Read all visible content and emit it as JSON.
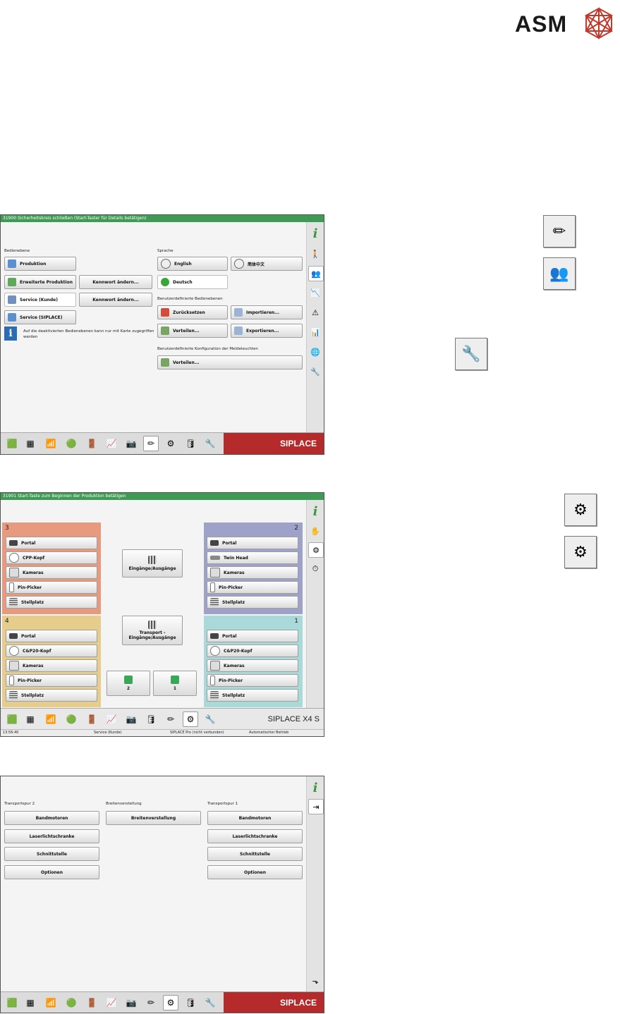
{
  "brand": {
    "logo_text": "ASM"
  },
  "screen1": {
    "status": "31900 Sicherheitskreis schließen (Start-Taster für Details betätigen)",
    "left_label": "Bedienebene",
    "levels": [
      {
        "label": "Produktion"
      },
      {
        "label": "Erweiterte Produktion"
      },
      {
        "label": "Service (Kunde)"
      },
      {
        "label": "Service (SIPLACE)"
      }
    ],
    "pw_buttons": [
      "Kennwort ändern...",
      "Kennwort ändern..."
    ],
    "info_text_line1": "Auf die deaktivierten Bedienebenen kann nur mit Karte zugegriffen",
    "info_text_line2": "werden",
    "lang_label": "Sprache",
    "langs": [
      "English",
      "简体中文",
      "Deutsch"
    ],
    "user_levels_label": "Benutzerdefinierte Bedienebenen",
    "user_buttons": [
      "Zurücksetzen",
      "Importieren...",
      "Verteilen...",
      "Exportieren..."
    ],
    "signal_label": "Benutzerdefinierte Konfiguration der Meldeleuchten",
    "signal_button": "Verteilen...",
    "siplace": "SIPLACE"
  },
  "screen2": {
    "status": "31901 Start-Taste zum Beginnen der Produktion betätigen",
    "quads": [
      {
        "num": "3",
        "color": "#e79a7d",
        "items": [
          "Portal",
          "CPP-Kopf",
          "Kameras",
          "Pin-Picker",
          "Stellplatz"
        ]
      },
      {
        "num": "2",
        "color": "#9ea2c8",
        "items": [
          "Portal",
          "Twin Head",
          "Kameras",
          "Pin-Picker",
          "Stellplatz"
        ]
      },
      {
        "num": "4",
        "color": "#e6cd8c",
        "items": [
          "Portal",
          "C&P20-Kopf",
          "Kameras",
          "Pin-Picker",
          "Stellplatz"
        ]
      },
      {
        "num": "1",
        "color": "#a9d9d9",
        "items": [
          "Portal",
          "C&P20-Kopf",
          "Kameras",
          "Pin-Picker",
          "Stellplatz"
        ]
      }
    ],
    "center_buttons": [
      "Eingänge/Ausgänge",
      "Transport - Eingänge/Ausgänge"
    ],
    "small_buttons": [
      "2",
      "1"
    ],
    "siplace": "SIPLACE X4 S",
    "footer": {
      "time": "13:56:40",
      "level": "Service (Kunde)",
      "pro": "SIPLACE Pro (nicht verbunden)",
      "mode": "Automatischer Betrieb"
    }
  },
  "screen3": {
    "col_labels": [
      "Transportspur 2",
      "Breitenverstellung",
      "Transportspur 1"
    ],
    "col1": [
      "Bandmotoren",
      "Laserlichtschranke",
      "Schnittstelle",
      "Optionen"
    ],
    "col2": [
      "Breitenverstellung"
    ],
    "col3": [
      "Bandmotoren",
      "Laserlichtschranke",
      "Schnittstelle",
      "Optionen"
    ],
    "siplace": "SIPLACE"
  },
  "colors": {
    "status_green": "#3f9a54",
    "siplace_red": "#b52a2a",
    "info_blue": "#2a6db5"
  }
}
